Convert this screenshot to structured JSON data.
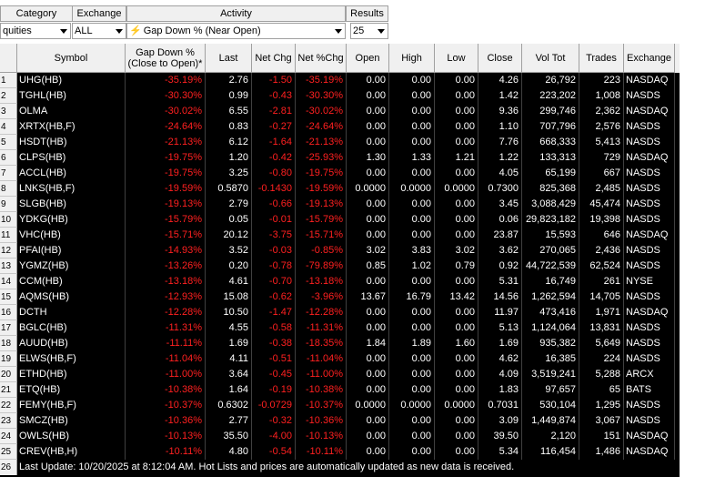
{
  "filters": {
    "category": {
      "label": "Category",
      "value": "quities"
    },
    "exchange": {
      "label": "Exchange",
      "value": "ALL"
    },
    "activity": {
      "label": "Activity",
      "value": "Gap Down % (Near Open)"
    },
    "results": {
      "label": "Results",
      "value": "25"
    }
  },
  "columns": [
    "Symbol",
    "Gap Down %\n(Close to Open)*",
    "Last",
    "Net Chg",
    "Net %Chg",
    "Open",
    "High",
    "Low",
    "Close",
    "Vol Tot",
    "Trades",
    "Exchange"
  ],
  "rows": [
    [
      "1",
      "UHG(HB)",
      "-35.19%",
      "2.76",
      "-1.50",
      "-35.19%",
      "0.00",
      "0.00",
      "0.00",
      "4.26",
      "26,792",
      "223",
      "NASDAQ"
    ],
    [
      "2",
      "TGHL(HB)",
      "-30.30%",
      "0.99",
      "-0.43",
      "-30.30%",
      "0.00",
      "0.00",
      "0.00",
      "1.42",
      "223,202",
      "1,008",
      "NASDS"
    ],
    [
      "3",
      "OLMA",
      "-30.02%",
      "6.55",
      "-2.81",
      "-30.02%",
      "0.00",
      "0.00",
      "0.00",
      "9.36",
      "299,746",
      "2,362",
      "NASDAQ"
    ],
    [
      "4",
      "XRTX(HB,F)",
      "-24.64%",
      "0.83",
      "-0.27",
      "-24.64%",
      "0.00",
      "0.00",
      "0.00",
      "1.10",
      "707,796",
      "2,576",
      "NASDS"
    ],
    [
      "5",
      "HSDT(HB)",
      "-21.13%",
      "6.12",
      "-1.64",
      "-21.13%",
      "0.00",
      "0.00",
      "0.00",
      "7.76",
      "668,333",
      "5,413",
      "NASDS"
    ],
    [
      "6",
      "CLPS(HB)",
      "-19.75%",
      "1.20",
      "-0.42",
      "-25.93%",
      "1.30",
      "1.33",
      "1.21",
      "1.22",
      "133,313",
      "729",
      "NASDAQ"
    ],
    [
      "7",
      "ACCL(HB)",
      "-19.75%",
      "3.25",
      "-0.80",
      "-19.75%",
      "0.00",
      "0.00",
      "0.00",
      "4.05",
      "65,199",
      "667",
      "NASDS"
    ],
    [
      "8",
      "LNKS(HB,F)",
      "-19.59%",
      "0.5870",
      "-0.1430",
      "-19.59%",
      "0.0000",
      "0.0000",
      "0.0000",
      "0.7300",
      "825,368",
      "2,485",
      "NASDS"
    ],
    [
      "9",
      "SLGB(HB)",
      "-19.13%",
      "2.79",
      "-0.66",
      "-19.13%",
      "0.00",
      "0.00",
      "0.00",
      "3.45",
      "3,088,429",
      "45,474",
      "NASDS"
    ],
    [
      "10",
      "YDKG(HB)",
      "-15.79%",
      "0.05",
      "-0.01",
      "-15.79%",
      "0.00",
      "0.00",
      "0.00",
      "0.06",
      "29,823,182",
      "19,398",
      "NASDS"
    ],
    [
      "11",
      "VHC(HB)",
      "-15.71%",
      "20.12",
      "-3.75",
      "-15.71%",
      "0.00",
      "0.00",
      "0.00",
      "23.87",
      "15,593",
      "646",
      "NASDAQ"
    ],
    [
      "12",
      "PFAI(HB)",
      "-14.93%",
      "3.52",
      "-0.03",
      "-0.85%",
      "3.02",
      "3.83",
      "3.02",
      "3.62",
      "270,065",
      "2,436",
      "NASDS"
    ],
    [
      "13",
      "YGMZ(HB)",
      "-13.26%",
      "0.20",
      "-0.78",
      "-79.89%",
      "0.85",
      "1.02",
      "0.79",
      "0.92",
      "44,722,539",
      "62,524",
      "NASDS"
    ],
    [
      "14",
      "CCM(HB)",
      "-13.18%",
      "4.61",
      "-0.70",
      "-13.18%",
      "0.00",
      "0.00",
      "0.00",
      "5.31",
      "16,749",
      "261",
      "NYSE"
    ],
    [
      "15",
      "AQMS(HB)",
      "-12.93%",
      "15.08",
      "-0.62",
      "-3.96%",
      "13.67",
      "16.79",
      "13.42",
      "14.56",
      "1,262,594",
      "14,705",
      "NASDS"
    ],
    [
      "16",
      "DCTH",
      "-12.28%",
      "10.50",
      "-1.47",
      "-12.28%",
      "0.00",
      "0.00",
      "0.00",
      "11.97",
      "473,416",
      "1,971",
      "NASDAQ"
    ],
    [
      "17",
      "BGLC(HB)",
      "-11.31%",
      "4.55",
      "-0.58",
      "-11.31%",
      "0.00",
      "0.00",
      "0.00",
      "5.13",
      "1,124,064",
      "13,831",
      "NASDS"
    ],
    [
      "18",
      "AUUD(HB)",
      "-11.11%",
      "1.69",
      "-0.38",
      "-18.35%",
      "1.84",
      "1.89",
      "1.60",
      "1.69",
      "935,382",
      "5,649",
      "NASDS"
    ],
    [
      "19",
      "ELWS(HB,F)",
      "-11.04%",
      "4.11",
      "-0.51",
      "-11.04%",
      "0.00",
      "0.00",
      "0.00",
      "4.62",
      "16,385",
      "224",
      "NASDS"
    ],
    [
      "20",
      "ETHD(HB)",
      "-11.00%",
      "3.64",
      "-0.45",
      "-11.00%",
      "0.00",
      "0.00",
      "0.00",
      "4.09",
      "3,519,241",
      "5,288",
      "ARCX"
    ],
    [
      "21",
      "ETQ(HB)",
      "-10.38%",
      "1.64",
      "-0.19",
      "-10.38%",
      "0.00",
      "0.00",
      "0.00",
      "1.83",
      "97,657",
      "65",
      "BATS"
    ],
    [
      "22",
      "FEMY(HB,F)",
      "-10.37%",
      "0.6302",
      "-0.0729",
      "-10.37%",
      "0.0000",
      "0.0000",
      "0.0000",
      "0.7031",
      "530,104",
      "1,295",
      "NASDS"
    ],
    [
      "23",
      "SMCZ(HB)",
      "-10.36%",
      "2.77",
      "-0.32",
      "-10.36%",
      "0.00",
      "0.00",
      "0.00",
      "3.09",
      "1,449,874",
      "3,067",
      "NASDS"
    ],
    [
      "24",
      "OWLS(HB)",
      "-10.13%",
      "35.50",
      "-4.00",
      "-10.13%",
      "0.00",
      "0.00",
      "0.00",
      "39.50",
      "2,120",
      "151",
      "NASDAQ"
    ],
    [
      "25",
      "CREV(HB,H)",
      "-10.11%",
      "4.80",
      "-0.54",
      "-10.11%",
      "0.00",
      "0.00",
      "0.00",
      "5.34",
      "116,454",
      "1,486",
      "NASDAQ"
    ]
  ],
  "footer": {
    "row_number": "26",
    "text": "Last Update: 10/20/2025 at 8:12:04 AM.  Hot Lists and prices are automatically updated as new data is received."
  },
  "colors": {
    "grid_background": "#000000",
    "positive_text": "#ffffff",
    "negative_text": "#ff2020",
    "header_background": "#f0f0f0"
  },
  "icons": {
    "activity": "lightning-bolt-icon",
    "dropdown": "chevron-down-icon"
  }
}
